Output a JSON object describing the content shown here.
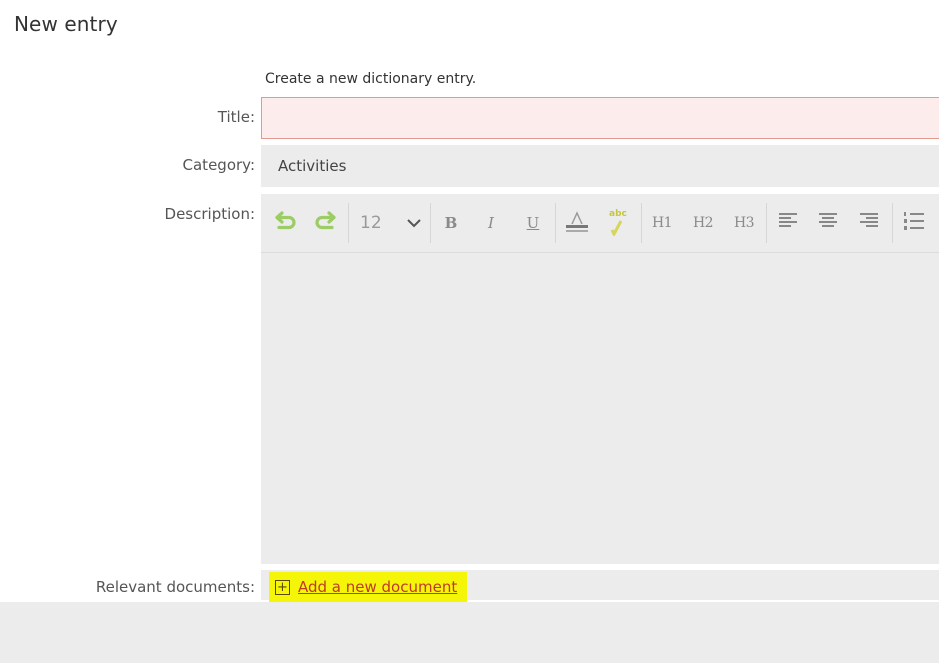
{
  "page": {
    "title": "New entry",
    "intro": "Create a new dictionary entry."
  },
  "form": {
    "title_label": "Title:",
    "title_value": "",
    "category_label": "Category:",
    "category_value": "Activities",
    "description_label": "Description:",
    "documents_label": "Relevant documents:",
    "add_document": "Add a new document"
  },
  "toolbar": {
    "font_size": "12",
    "bold": "B",
    "italic": "I",
    "underline": "U",
    "h1": "H1",
    "h2": "H2",
    "h3": "H3",
    "spell_badge": "abc"
  },
  "colors": {
    "title_error_bg": "#fdecec",
    "title_error_border": "#e29a8f",
    "field_bg": "#ececec",
    "undo_redo_green": "#9ccc65",
    "highlight_yellow": "#f5f50a",
    "link_red": "#c0392b"
  },
  "icons": [
    "undo-icon",
    "redo-icon",
    "chevron-down-icon",
    "text-color-icon",
    "spellcheck-icon",
    "align-left-icon",
    "align-center-icon",
    "align-right-icon",
    "ordered-list-icon",
    "plus-square-icon"
  ]
}
